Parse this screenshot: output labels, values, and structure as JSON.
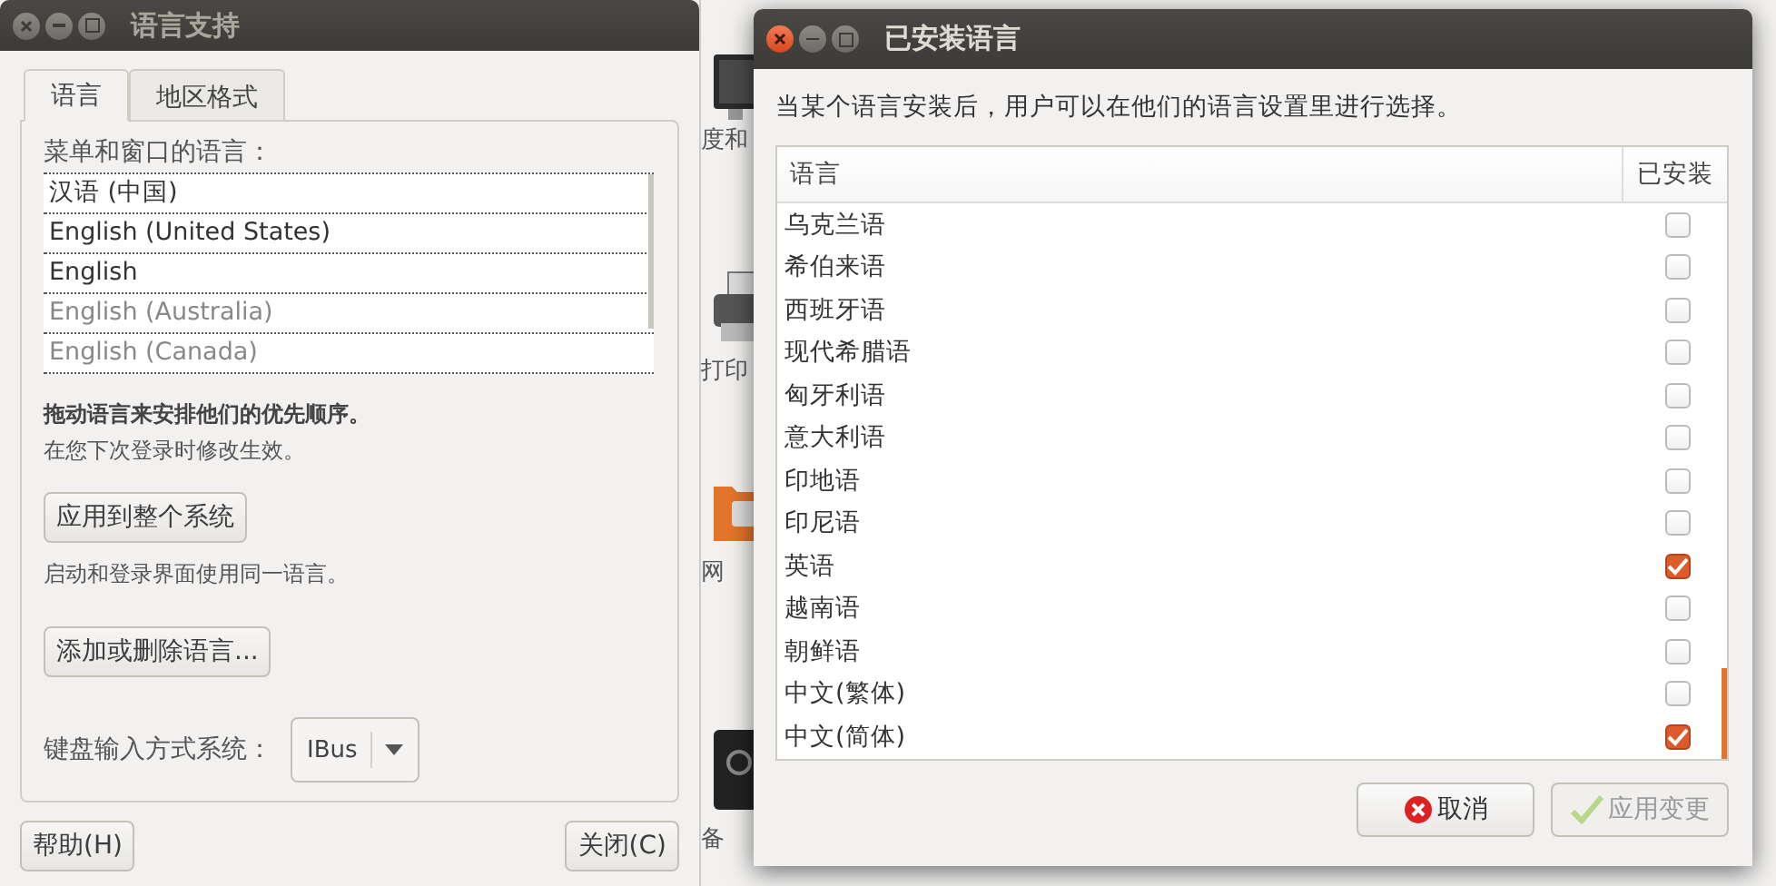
{
  "background_window": {
    "labels": [
      "度和",
      "打印",
      "网",
      "备"
    ]
  },
  "language_support": {
    "title": "语言支持",
    "tabs": [
      {
        "label": "语言",
        "selected": true
      },
      {
        "label": "地区格式",
        "selected": false
      }
    ],
    "list_label": "菜单和窗口的语言：",
    "languages": [
      {
        "name": "汉语 (中国)",
        "disabled": false
      },
      {
        "name": "English (United States)",
        "disabled": false
      },
      {
        "name": "English",
        "disabled": false
      },
      {
        "name": "English (Australia)",
        "disabled": true
      },
      {
        "name": "English (Canada)",
        "disabled": true
      }
    ],
    "hint_bold": "拖动语言来安排他们的优先顺序。",
    "hint": "在您下次登录时修改生效。",
    "apply_button": "应用到整个系统",
    "apply_hint": "启动和登录界面使用同一语言。",
    "add_remove_button": "添加或删除语言...",
    "input_label": "键盘输入方式系统：",
    "input_value": "IBus",
    "help_button": "帮助(H)",
    "close_button": "关闭(C)"
  },
  "installed_languages": {
    "title": "已安装语言",
    "description": "当某个语言安装后，用户可以在他们的语言设置里进行选择。",
    "columns": [
      "语言",
      "已安装"
    ],
    "rows": [
      {
        "name": "乌克兰语",
        "checked": false
      },
      {
        "name": "希伯来语",
        "checked": false
      },
      {
        "name": "西班牙语",
        "checked": false
      },
      {
        "name": "现代希腊语",
        "checked": false
      },
      {
        "name": "匈牙利语",
        "checked": false
      },
      {
        "name": "意大利语",
        "checked": false
      },
      {
        "name": "印地语",
        "checked": false
      },
      {
        "name": "印尼语",
        "checked": false
      },
      {
        "name": "英语",
        "checked": true
      },
      {
        "name": "越南语",
        "checked": false
      },
      {
        "name": "朝鲜语",
        "checked": false
      },
      {
        "name": "中文(繁体)",
        "checked": false
      },
      {
        "name": "中文(简体)",
        "checked": true
      }
    ],
    "cancel_button": "取消",
    "apply_button": "应用变更"
  }
}
